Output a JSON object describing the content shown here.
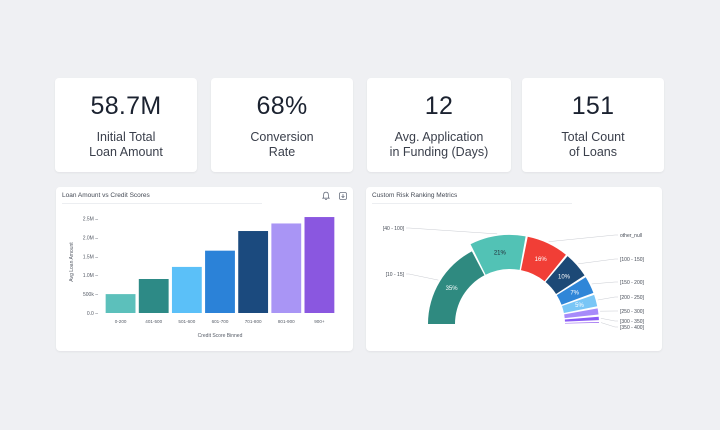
{
  "kpis": [
    {
      "value": "58.7M",
      "label": "Initial Total\nLoan Amount"
    },
    {
      "value": "68%",
      "label": "Conversion\nRate"
    },
    {
      "value": "12",
      "label": "Avg. Application\nin Funding (Days)"
    },
    {
      "value": "151",
      "label": "Total Count\nof Loans"
    }
  ],
  "bar_panel": {
    "title": "Loan Amount vs Credit Scores",
    "icons": [
      "bell-icon",
      "export-icon"
    ]
  },
  "risk_panel": {
    "title": "Custom Risk Ranking Metrics"
  },
  "chart_data": [
    {
      "type": "bar",
      "title": "Loan Amount vs Credit Scores",
      "xlabel": "Credit Score Binned",
      "ylabel": "Avg Loan Amount",
      "categories": [
        "0-200",
        "401-500",
        "501-600",
        "601-700",
        "701-800",
        "801-900",
        "900+"
      ],
      "values": [
        500000,
        900000,
        1220000,
        1650000,
        2170000,
        2370000,
        2540000
      ],
      "colors": [
        "#5cc0bb",
        "#2d8a86",
        "#5bc0f8",
        "#2b82d8",
        "#1b4a7e",
        "#a995f5",
        "#8a57e0"
      ],
      "ylim": [
        0,
        2700000
      ],
      "yticks": [
        0,
        500000,
        1000000,
        1500000,
        2000000,
        2500000
      ],
      "ytick_labels": [
        "0.0 –",
        "500k –",
        "1.0M –",
        "1.5M –",
        "2.0M –",
        "2.5M –"
      ],
      "grid": false
    },
    {
      "type": "pie",
      "title": "Custom Risk Ranking Metrics",
      "style": "semi-donut",
      "slices": [
        {
          "label": "[10 - 15]",
          "value": 35,
          "text": "35%",
          "color": "#2f8a80"
        },
        {
          "label": "[40 - 100]",
          "value": 21,
          "text": "21%",
          "color": "#52c2b5"
        },
        {
          "label": "other_null",
          "value": 16,
          "text": "16%",
          "color": "#f13e36"
        },
        {
          "label": "[100 - 150]",
          "value": 10,
          "text": "10%",
          "color": "#1c4976"
        },
        {
          "label": "[150 - 200]",
          "value": 7,
          "text": "7%",
          "color": "#2f86d8"
        },
        {
          "label": "[200 - 250]",
          "value": 5,
          "text": "5%",
          "color": "#79c6f6"
        },
        {
          "label": "[250 - 300]",
          "value": 3,
          "text": "",
          "color": "#a78bfa"
        },
        {
          "label": "[300 - 350]",
          "value": 2,
          "text": "",
          "color": "#8b5cf6"
        },
        {
          "label": "[350 - 400]",
          "value": 1,
          "text": "",
          "color": "#7c3aed"
        }
      ]
    }
  ]
}
